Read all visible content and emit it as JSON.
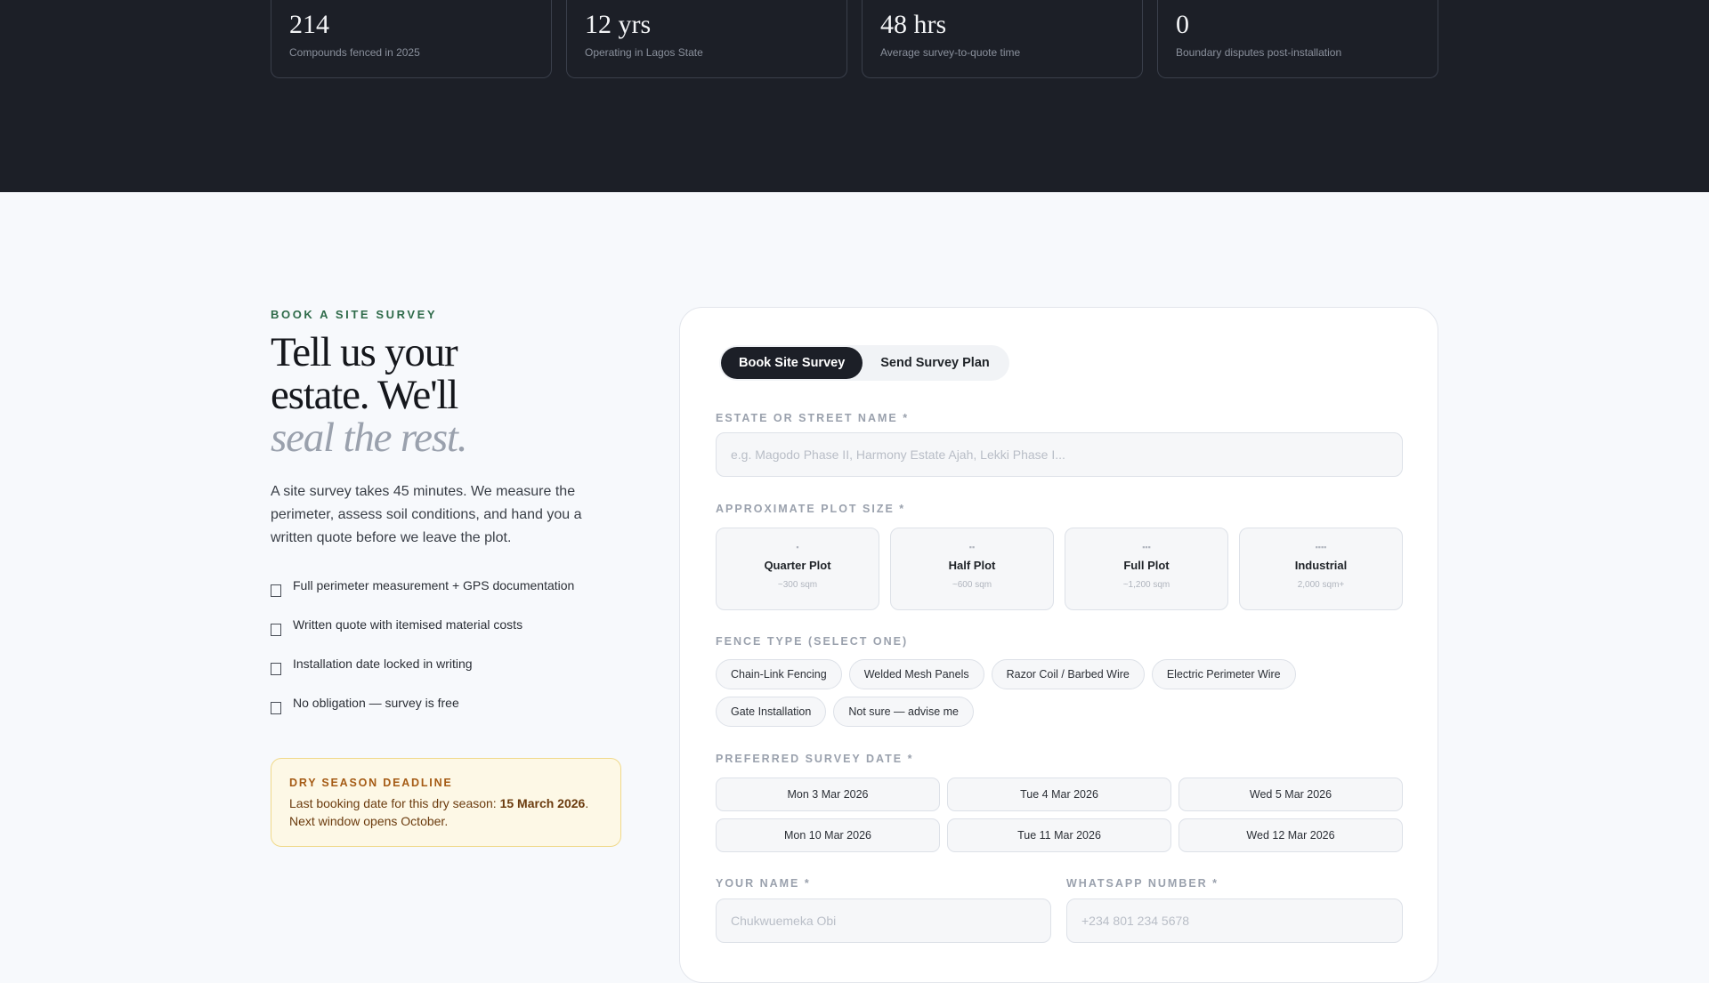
{
  "stats": [
    {
      "value": "214",
      "label": "Compounds fenced in 2025"
    },
    {
      "value": "12 yrs",
      "label": "Operating in Lagos State"
    },
    {
      "value": "48 hrs",
      "label": "Average survey-to-quote time"
    },
    {
      "value": "0",
      "label": "Boundary disputes post-installation"
    }
  ],
  "intro_section": {
    "eyebrow": "BOOK A SITE SURVEY",
    "headline_line1": "Tell us your",
    "headline_line2": "estate. We'll",
    "headline_line3": "seal the rest.",
    "body": "A site survey takes 45 minutes. We measure the perimeter, assess soil conditions, and hand you a written quote before we leave the plot.",
    "checklist": [
      "Full perimeter measurement + GPS documentation",
      "Written quote with itemised material costs",
      "Installation date locked in writing",
      "No obligation — survey is free"
    ],
    "deadline": {
      "title": "DRY SEASON DEADLINE",
      "text_before": "Last booking date for this dry season: ",
      "date": "15 March 2026",
      "text_after": ". Next window opens October."
    }
  },
  "form": {
    "tabs": [
      "Book Site Survey",
      "Send Survey Plan"
    ],
    "active_tab": "Book Site Survey",
    "estate_label": "ESTATE OR STREET NAME *",
    "estate_placeholder": "e.g. Magodo Phase II, Harmony Estate Ajah, Lekki Phase I...",
    "plot_label": "APPROXIMATE PLOT SIZE *",
    "plots": [
      {
        "dots": "▪",
        "name": "Quarter Plot",
        "size": "~300 sqm"
      },
      {
        "dots": "▪▪",
        "name": "Half Plot",
        "size": "~600 sqm"
      },
      {
        "dots": "▪▪▪",
        "name": "Full Plot",
        "size": "~1,200 sqm"
      },
      {
        "dots": "▪▪▪▪",
        "name": "Industrial",
        "size": "2,000 sqm+"
      }
    ],
    "fence_label": "FENCE TYPE (SELECT ONE)",
    "fence_types": [
      "Chain-Link Fencing",
      "Welded Mesh Panels",
      "Razor Coil / Barbed Wire",
      "Electric Perimeter Wire",
      "Gate Installation",
      "Not sure — advise me"
    ],
    "date_label": "PREFERRED SURVEY DATE *",
    "dates": [
      "Mon 3 Mar 2026",
      "Tue 4 Mar 2026",
      "Wed 5 Mar 2026",
      "Mon 10 Mar 2026",
      "Tue 11 Mar 2026",
      "Wed 12 Mar 2026"
    ],
    "name_label": "YOUR NAME *",
    "name_placeholder": "Chukwuemeka Obi",
    "whatsapp_label": "WHATSAPP NUMBER *",
    "whatsapp_placeholder": "+234 801 234 5678"
  }
}
